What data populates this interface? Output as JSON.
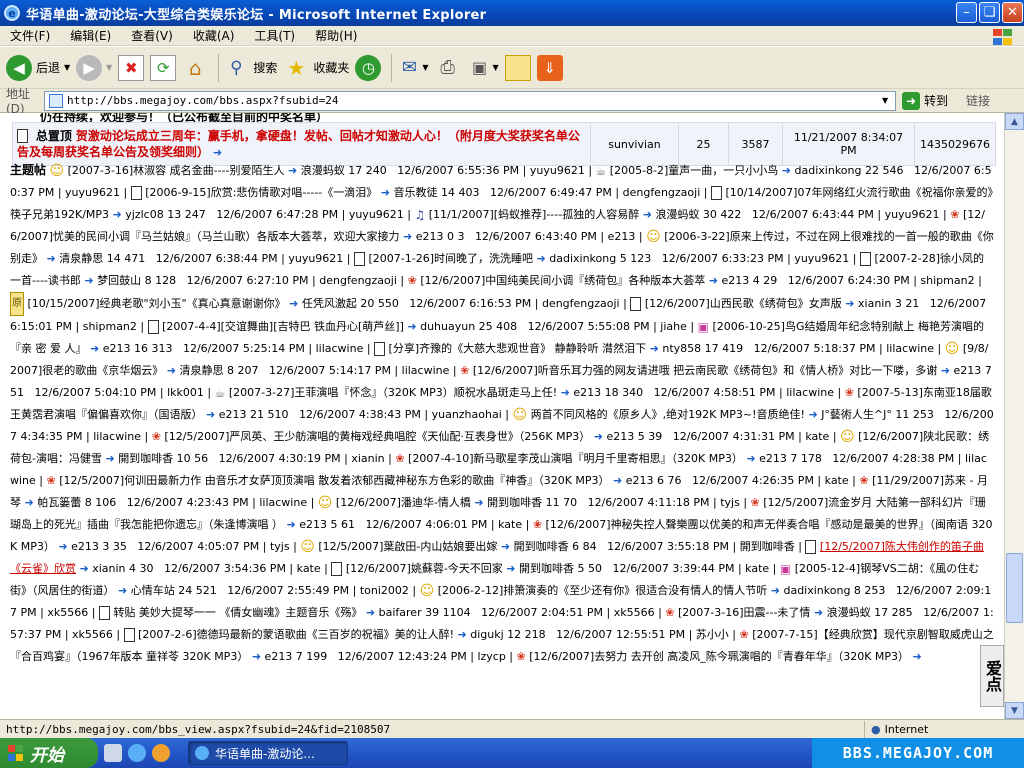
{
  "window": {
    "title": "华语单曲-激动论坛-大型综合类娱乐论坛 - Microsoft Internet Explorer"
  },
  "menu": [
    "文件(F)",
    "编辑(E)",
    "查看(V)",
    "收藏(A)",
    "工具(T)",
    "帮助(H)"
  ],
  "toolbar": {
    "back": "后退",
    "search": "搜索",
    "favorites": "收藏夹"
  },
  "address": {
    "label": "地址(D)",
    "url": "http://bbs.megajoy.com/bbs.aspx?fsubid=24",
    "go": "转到",
    "links": "链接"
  },
  "page": {
    "partial_line": "仍在持续，欢迎参与！（已公布截至目前的中奖名单）",
    "sticky": {
      "tag": "总置顶",
      "title": "贺激动论坛成立三周年：赢手机，拿硬盘！发帖、回帖才知激动人心！（附月度大奖获奖名单公告及每周获奖名单公告及领奖细则）",
      "author": "sunvivian",
      "replies": "25",
      "views": "3587",
      "lastpost": "11/21/2007 8:34:07 PM",
      "id": "1435029676"
    },
    "lead": "主题帖",
    "topics": [
      {
        "i": "smile",
        "t": "[2007-3-16]林淑容 成名金曲----别爱陌生人"
      },
      {
        "a": "浪漫蚂蚁 17 240"
      },
      {
        "d": "12/6/2007 6:55:36 PM"
      },
      {
        "u": "yuyu9621"
      },
      {
        "i": "tea",
        "t": "[2005-8-2]童声一曲，一只小小鸟"
      },
      {
        "a": "dadixinkong 22 546"
      },
      {
        "d": "12/6/2007 6:50:37 PM"
      },
      {
        "u": "yuyu9621"
      },
      {
        "i": "doc",
        "t": "[2006-9-15]欣赏:悲伤情歌对唱-----《一滴泪》"
      },
      {
        "a": "音乐教徒 14 403"
      },
      {
        "d": "12/6/2007 6:49:47 PM"
      },
      {
        "u": "dengfengzaoji"
      },
      {
        "i": "doc",
        "t": "[10/14/2007]07年网络红火流行歌曲《祝福你亲爱的》筷子兄弟192K/MP3"
      },
      {
        "a": "yjzlc08 13 247"
      },
      {
        "d": "12/6/2007 6:47:28 PM"
      },
      {
        "u": "yuyu9621"
      },
      {
        "i": "note",
        "t": "[11/1/2007][蚂蚁推荐]----孤独的人容易醉"
      },
      {
        "a": "浪漫蚂蚁 30 422"
      },
      {
        "d": "12/6/2007 6:43:44 PM"
      },
      {
        "u": "yuyu9621"
      },
      {
        "i": "flower",
        "t": "[12/6/2007]忧美的民间小调『马兰姑娘』（马兰山歌）各版本大荟萃，欢迎大家接力"
      },
      {
        "a": "e213 0 3"
      },
      {
        "d": "12/6/2007 6:43:40 PM"
      },
      {
        "u": "e213"
      },
      {
        "i": "smile",
        "t": "[2006-3-22]原来上传过，不过在网上很难找的一首一般的歌曲《你别走》"
      },
      {
        "a": "清泉静思 14 471"
      },
      {
        "d": "12/6/2007 6:38:44 PM"
      },
      {
        "u": "yuyu9621"
      },
      {
        "i": "doc",
        "t": "[2007-1-26]时间晚了，洗洗睡吧"
      },
      {
        "a": "dadixinkong 5 123"
      },
      {
        "d": "12/6/2007 6:33:23 PM"
      },
      {
        "u": "yuyu9621"
      },
      {
        "i": "doc",
        "t": "[2007-2-28]徐小凤的一首----读书郎"
      },
      {
        "a": "梦回鼓山 8 128"
      },
      {
        "d": "12/6/2007 6:27:10 PM"
      },
      {
        "u": "dengfengzaoji"
      },
      {
        "i": "flower",
        "t": "[12/6/2007]中国纯美民间小调『绣荷包』各种版本大荟萃"
      },
      {
        "a": "e213 4 29"
      },
      {
        "d": "12/6/2007 6:24:30 PM"
      },
      {
        "u": "shipman2"
      },
      {
        "i": "ybox",
        "t": "[10/15/2007]经典老歌\"刘小玉\"《真心真意谢谢你》"
      },
      {
        "a": "任凭风激起 20 550"
      },
      {
        "d": "12/6/2007 6:16:53 PM"
      },
      {
        "u": "dengfengzaoji"
      },
      {
        "i": "doc",
        "t": "[12/6/2007]山西民歌《绣荷包》女声版"
      },
      {
        "a": "xianin 3 21"
      },
      {
        "d": "12/6/2007 6:15:01 PM"
      },
      {
        "u": "shipman2"
      },
      {
        "i": "doc",
        "t": "[2007-4-4][交谊舞曲][吉特巴 铁血丹心[萌芦丝]]"
      },
      {
        "a": "duhuayun 25 408"
      },
      {
        "d": "12/6/2007 5:55:08 PM"
      },
      {
        "u": "jiahe"
      },
      {
        "i": "gift",
        "t": "[2006-10-25]鸟G结婚周年纪念特别献上 梅艳芳演唱的『亲 密 爱 人』"
      },
      {
        "a": "e213 16 313"
      },
      {
        "d": "12/6/2007 5:25:14 PM"
      },
      {
        "u": "lilacwine"
      },
      {
        "i": "doc",
        "t": "[分享]齐豫的《大慈大悲观世音》 静静聆听 潸然泪下"
      },
      {
        "a": "nty858 17 419"
      },
      {
        "d": "12/6/2007 5:18:37 PM"
      },
      {
        "u": "lilacwine"
      },
      {
        "i": "smile",
        "t": "[9/8/2007]很老的歌曲《京华烟云》"
      },
      {
        "a": "清泉静思 8 207"
      },
      {
        "d": "12/6/2007 5:14:17 PM"
      },
      {
        "u": "lilacwine"
      },
      {
        "i": "flower",
        "t": "[12/6/2007]听音乐耳力强的网友请进哦 把云南民歌《绣荷包》和《情人桥》对比一下喽，多谢"
      },
      {
        "a": "e213 7 51"
      },
      {
        "d": "12/6/2007 5:04:10 PM"
      },
      {
        "u": "lkk001"
      },
      {
        "i": "tea",
        "t": "[2007-3-27]王菲演唱『怀念』（320K MP3）顺祝水晶斑走马上任!"
      },
      {
        "a": "e213 18 340"
      },
      {
        "d": "12/6/2007 4:58:51 PM"
      },
      {
        "u": "lilacwine"
      },
      {
        "i": "flower",
        "t": "[2007-5-13]东南亚18届歌王黄霑君演唱『偏偏喜欢你』（国语版）"
      },
      {
        "a": "e213 21 510"
      },
      {
        "d": "12/6/2007 4:38:43 PM"
      },
      {
        "u": "yuanzhaohai"
      },
      {
        "i": "smile",
        "t": "两首不同风格的《原乡人》,绝对192K MP3~!音质绝佳!"
      },
      {
        "a": "J°藝術人生^J° 11 253"
      },
      {
        "d": "12/6/2007 4:34:35 PM"
      },
      {
        "u": "lilacwine"
      },
      {
        "i": "flower",
        "t": "[12/5/2007]严凤英、王少舫演唱的黄梅戏经典唱腔《天仙配·互表身世》（256K MP3）"
      },
      {
        "a": "e213 5 39"
      },
      {
        "d": "12/6/2007 4:31:31 PM"
      },
      {
        "u": "kate"
      },
      {
        "i": "smile",
        "t": "[12/6/2007]陕北民歌：绣荷包-演唱：冯健雪"
      },
      {
        "a": "開到咖啡香 10 56"
      },
      {
        "d": "12/6/2007 4:30:19 PM"
      },
      {
        "u": "xianin"
      },
      {
        "i": "flower",
        "t": "[2007-4-10]新马歌星李茂山演唱『明月千里寄相思』（320K MP3）"
      },
      {
        "a": "e213 7 178"
      },
      {
        "d": "12/6/2007 4:28:38 PM"
      },
      {
        "u": "lilacwine"
      },
      {
        "i": "flower",
        "t": "[12/5/2007]何训田最新力作 由音乐才女萨顶顶演唱 散发着浓郁西藏神秘东方色彩的歌曲『神香』（320K MP3）"
      },
      {
        "a": "e213 6 76"
      },
      {
        "d": "12/6/2007 4:26:35 PM"
      },
      {
        "u": "kate"
      },
      {
        "i": "flower",
        "t": "[11/29/2007]苏来 - 月琴"
      },
      {
        "a": "帕瓦篓蕾 8 106"
      },
      {
        "d": "12/6/2007 4:23:43 PM"
      },
      {
        "u": "lilacwine"
      },
      {
        "i": "smile",
        "t": "[12/6/2007]潘迪华-情人橋"
      },
      {
        "a": "開到咖啡香 11 70"
      },
      {
        "d": "12/6/2007 4:11:18 PM"
      },
      {
        "u": "tyjs"
      },
      {
        "i": "flower",
        "t": "[12/5/2007]流金岁月 大陆第一部科幻片『珊瑚岛上的死光』插曲『我怎能把你遗忘』（朱逢博演唱 ）"
      },
      {
        "a": "e213 5 61"
      },
      {
        "d": "12/6/2007 4:06:01 PM"
      },
      {
        "u": "kate"
      },
      {
        "i": "flower",
        "t": "[12/6/2007]神秘失控人聲樂團以优美的和声无伴奏合唱『感动是最美的世界』（闽南语 320K MP3）"
      },
      {
        "a": "e213 3 35"
      },
      {
        "d": "12/6/2007 4:05:07 PM"
      },
      {
        "u": "tyjs"
      },
      {
        "i": "smile",
        "t": "[12/5/2007]葉啟田-内山姑娘要出嫁"
      },
      {
        "a": "開到咖啡香 6 84"
      },
      {
        "d": "12/6/2007 3:55:18 PM"
      },
      {
        "u": "開到咖啡香"
      },
      {
        "i": "doc",
        "hl": true,
        "t": "[12/5/2007]陈大伟创作的笛子曲《云雀》欣赏"
      },
      {
        "a": "xianin 4 30"
      },
      {
        "d": "12/6/2007 3:54:36 PM"
      },
      {
        "u": "kate"
      },
      {
        "i": "doc",
        "t": "[12/6/2007]姚蘇蓉-今天不回家"
      },
      {
        "a": "開到咖啡香 5 50"
      },
      {
        "d": "12/6/2007 3:39:44 PM"
      },
      {
        "u": "kate"
      },
      {
        "i": "gift",
        "t": "[2005-12-4]钢琴VS二胡：《風の住む街》（风居住的街道）"
      },
      {
        "a": "心情车站 24 521"
      },
      {
        "d": "12/6/2007 2:55:49 PM"
      },
      {
        "u": "toni2002"
      },
      {
        "i": "smile",
        "t": "[2006-2-12]排箫演奏的《至少还有你》很适合没有情人的情人节听"
      },
      {
        "a": "dadixinkong 8 253"
      },
      {
        "d": "12/6/2007 2:09:17 PM"
      },
      {
        "u": "xk5566"
      },
      {
        "i": "doc",
        "t": "转贴 美妙大提琴一一 《倩女幽魂》主题音乐《殇》"
      },
      {
        "a": "baifarer 39 1104"
      },
      {
        "d": "12/6/2007 2:04:51 PM"
      },
      {
        "u": "xk5566"
      },
      {
        "i": "flower",
        "t": "[2007-3-16]田震---未了情"
      },
      {
        "a": "浪漫蚂蚁 17 285"
      },
      {
        "d": "12/6/2007 1:57:37 PM"
      },
      {
        "u": "xk5566"
      },
      {
        "i": "doc",
        "t": "[2007-2-6]德德玛最新的蒙语歌曲《三百岁的祝福》美的让人醉!"
      },
      {
        "a": "digukj 12 218"
      },
      {
        "d": "12/6/2007 12:55:51 PM"
      },
      {
        "u": "苏小小"
      },
      {
        "i": "flower",
        "t": "[2007-7-15]【经典欣赏】现代京剧智取威虎山之『合百鸡宴』（1967年版本 童祥苓 320K MP3）"
      },
      {
        "a": "e213 7 199"
      },
      {
        "d": "12/6/2007 12:43:24 PM"
      },
      {
        "u": "lzycp"
      },
      {
        "i": "flower",
        "t": "[12/6/2007]去努力 去开创 高凌风_陈今珮演唱的『青春年华』（320K MP3）"
      }
    ],
    "side_badge": "爱点"
  },
  "status": {
    "url": "http://bbs.megajoy.com/bbs_view.aspx?fsubid=24&fid=2108507",
    "zone": "Internet"
  },
  "taskbar": {
    "start": "开始",
    "window": "华语单曲-激动论...",
    "tray": "BBS.MEGAJOY.COM"
  },
  "colors": {
    "title_blue": "#0846b3",
    "chrome": "#ece9d8",
    "hot_red": "#cc0000",
    "link_blue": "#1a5fc8"
  }
}
